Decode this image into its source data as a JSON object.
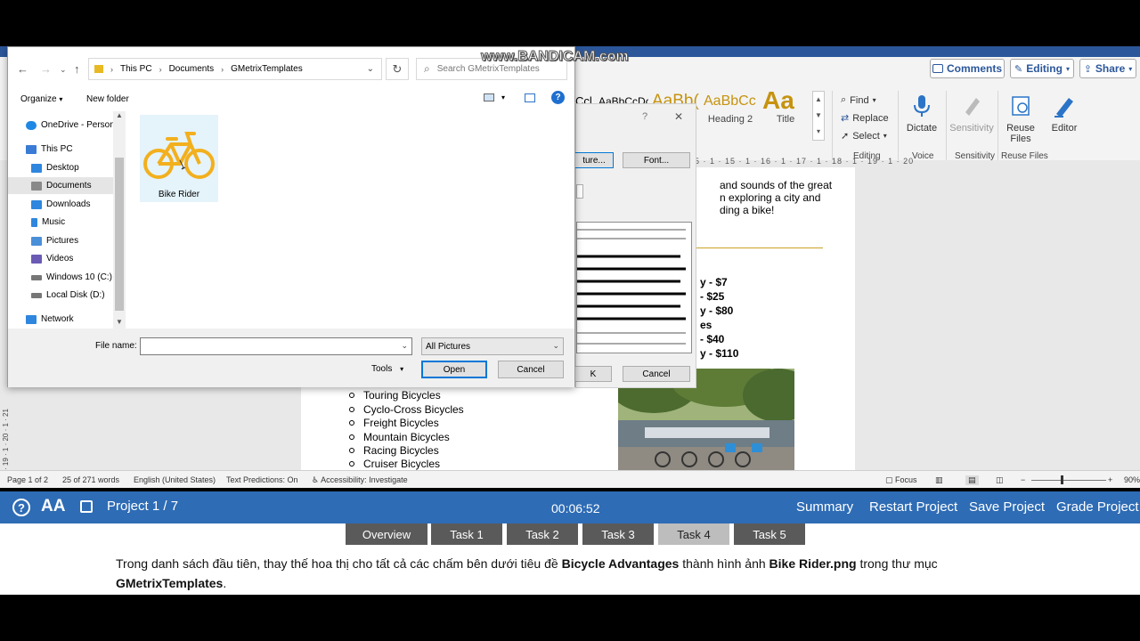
{
  "watermark": "www.BANDICAM.com",
  "ribbon": {
    "comments_label": "Comments",
    "editing_label": "Editing",
    "share_label": "Share",
    "styles": [
      {
        "preview": "Ccl",
        "name": ""
      },
      {
        "preview": "AaBbCcDc",
        "name": ""
      },
      {
        "preview": "AaBb(",
        "name": ""
      },
      {
        "preview": "AaBbCc",
        "name": "Heading 2"
      },
      {
        "preview": "Aa",
        "name": "Title"
      }
    ],
    "find_label": "Find",
    "replace_label": "Replace",
    "select_label": "Select",
    "dictate_label": "Dictate",
    "sensitivity_label": "Sensitivity",
    "reuse_files_label": "Reuse Files",
    "editor_label": "Editor",
    "group_editing": "Editing",
    "group_voice": "Voice",
    "group_sensitivity": "Sensitivity",
    "group_reuse": "Reuse Files"
  },
  "ruler": "5 · 1 · 15 · 1 · 16 · 1 · 17 · 1 · 18 · 1 · 19 · 1 · 20",
  "document": {
    "lines_top": [
      "and sounds of the great",
      "n exploring a city and",
      "ding a bike!"
    ],
    "price_lines": [
      "y - $7",
      "- $25",
      "y - $80",
      "es",
      "- $40",
      "y - $110"
    ],
    "bullets": [
      "Touring Bicycles",
      "Cyclo-Cross Bicycles",
      "Freight Bicycles",
      "Mountain Bicycles",
      "Racing Bicycles",
      "Cruiser Bicycles"
    ]
  },
  "vruler": "· 19 · 1 · 20 · 1 · 21",
  "statusbar": {
    "page": "Page 1 of 2",
    "words": "25 of 271 words",
    "language": "English (United States)",
    "predictions": "Text Predictions: On",
    "accessibility": "Accessibility: Investigate",
    "focus": "Focus",
    "zoom": "90%"
  },
  "bg_dialog": {
    "question": "?",
    "close": "✕",
    "picture_btn": "ture...",
    "font_btn": "Font...",
    "ok_btn": "K",
    "cancel_btn": "Cancel"
  },
  "file_dialog": {
    "path": [
      "This PC",
      "Documents",
      "GMetrixTemplates"
    ],
    "search_placeholder": "Search GMetrixTemplates",
    "organize": "Organize",
    "new_folder": "New folder",
    "help": "?",
    "tree": [
      {
        "label": "OneDrive - Person",
        "icon": "cloud-icon",
        "color": "#1e88e5"
      },
      {
        "label": "This PC",
        "icon": "pc-icon",
        "color": "#3a7bd5"
      },
      {
        "label": "Desktop",
        "icon": "desktop-icon",
        "color": "#2e86de"
      },
      {
        "label": "Documents",
        "icon": "documents-icon",
        "color": "#8a8a8a"
      },
      {
        "label": "Downloads",
        "icon": "downloads-icon",
        "color": "#2e86de"
      },
      {
        "label": "Music",
        "icon": "music-icon",
        "color": "#2e86de"
      },
      {
        "label": "Pictures",
        "icon": "pictures-icon",
        "color": "#4a90d9"
      },
      {
        "label": "Videos",
        "icon": "videos-icon",
        "color": "#6b5bb5"
      },
      {
        "label": "Windows 10 (C:)",
        "icon": "drive-icon",
        "color": "#777777"
      },
      {
        "label": "Local Disk (D:)",
        "icon": "drive-icon",
        "color": "#777777"
      },
      {
        "label": "Network",
        "icon": "network-icon",
        "color": "#2e86de"
      }
    ],
    "file_name": "Bike Rider",
    "file_name_label": "File name:",
    "file_name_value": "",
    "file_type": "All Pictures",
    "tools": "Tools",
    "open": "Open",
    "cancel": "Cancel"
  },
  "gmetrix": {
    "project": "Project 1 / 7",
    "timer": "00:06:52",
    "summary": "Summary",
    "restart": "Restart Project",
    "save": "Save Project",
    "grade": "Grade Project",
    "tabs": [
      "Overview",
      "Task 1",
      "Task 2",
      "Task 3",
      "Task 4",
      "Task 5"
    ],
    "active_tab": "Task 4",
    "instruction_pre": "Trong danh sách đầu tiên, thay thế hoa thị cho tất cả các chấm bên dưới tiêu đề ",
    "instruction_bold1": "Bicycle Advantages",
    "instruction_mid": " thành hình ảnh ",
    "instruction_bold2": "Bike Rider.png",
    "instruction_post": " trong thư mục",
    "instruction_bold3": "GMetrixTemplates",
    "instruction_end": "."
  },
  "colors": {
    "accent": "#0078d7",
    "gmetrix_blue": "#2e6cb5",
    "bike_yellow": "#f2b01e"
  }
}
